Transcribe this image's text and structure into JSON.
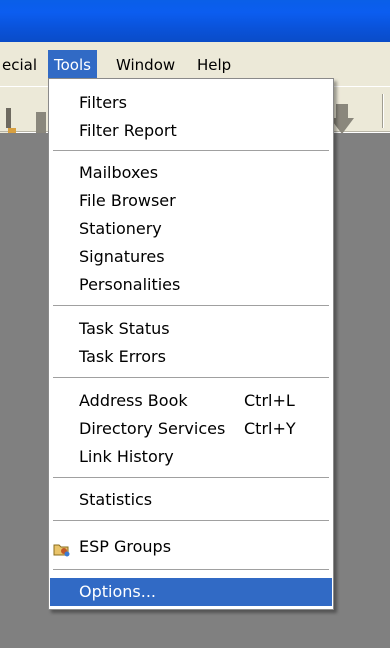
{
  "menubar": {
    "items": [
      {
        "label": "ecial"
      },
      {
        "label": "Tools"
      },
      {
        "label": "Window"
      },
      {
        "label": "Help"
      }
    ]
  },
  "tools_menu": {
    "filters": "Filters",
    "filter_report": "Filter Report",
    "mailboxes": "Mailboxes",
    "file_browser": "File Browser",
    "stationery": "Stationery",
    "signatures": "Signatures",
    "personalities": "Personalities",
    "task_status": "Task Status",
    "task_errors": "Task Errors",
    "address_book": "Address Book",
    "address_book_shortcut": "Ctrl+L",
    "directory_services": "Directory Services",
    "directory_services_shortcut": "Ctrl+Y",
    "link_history": "Link History",
    "statistics": "Statistics",
    "esp_groups": "ESP Groups",
    "esp_groups_icon": "folder-group-icon",
    "options": "Options..."
  },
  "colors": {
    "titlebar": "#0a5fe8",
    "highlight": "#316ac5",
    "chrome": "#ece9d8",
    "workspace": "#808080"
  }
}
